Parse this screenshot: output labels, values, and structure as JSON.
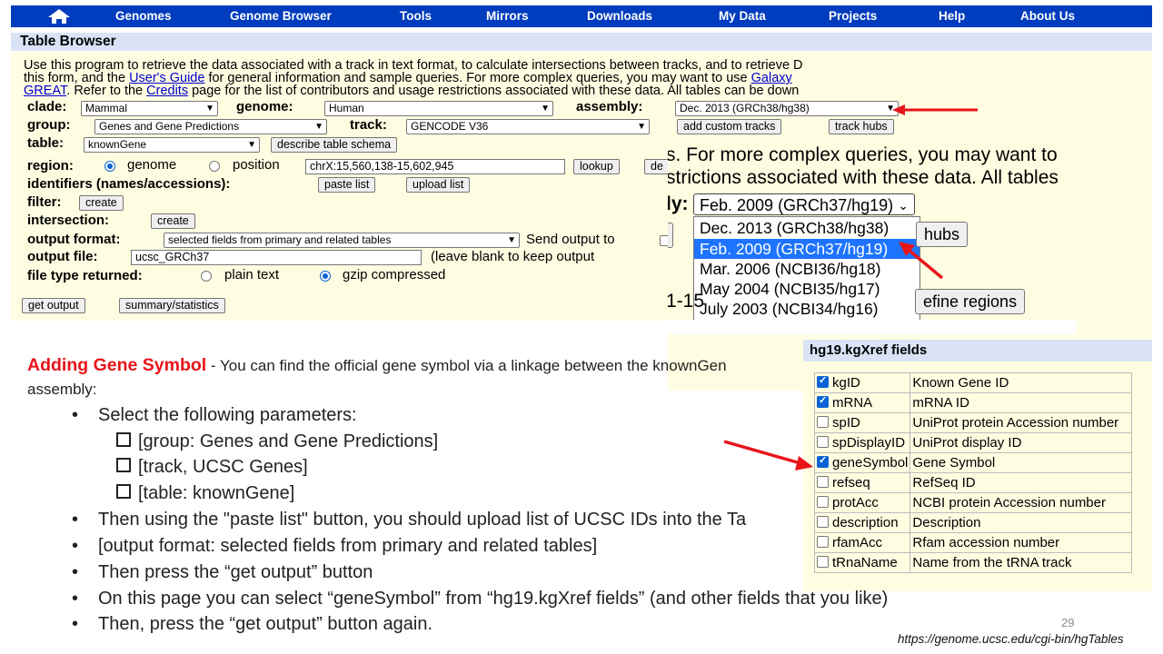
{
  "nav": {
    "items": [
      "Genomes",
      "Genome Browser",
      "Tools",
      "Mirrors",
      "Downloads",
      "My Data",
      "Projects",
      "Help",
      "About Us"
    ]
  },
  "table_browser": {
    "title": "Table Browser",
    "intro": {
      "line1": "Use this program to retrieve the data associated with a track in text format, to calculate intersections between tracks, and to retrieve D",
      "line2_a": "this form, and the ",
      "line2_link1": "User's Guide",
      "line2_b": " for general information and sample queries. For more complex queries, you may want to use ",
      "line2_link2": "Galaxy",
      "line3_link": "GREAT",
      "line3_a": ". Refer to the ",
      "line3_link2": "Credits",
      "line3_b": " page for the list of contributors and usage restrictions associated with these data. All tables can be down"
    },
    "clade_label": "clade:",
    "clade_value": "Mammal",
    "genome_label": "genome:",
    "genome_value": "Human",
    "assembly_label": "assembly:",
    "assembly_value": "Dec. 2013 (GRCh38/hg38)",
    "group_label": "group:",
    "group_value": "Genes and Gene Predictions",
    "track_label": "track:",
    "track_value": "GENCODE V36",
    "add_custom_tracks": "add custom tracks",
    "track_hubs": "track hubs",
    "table_label": "table:",
    "table_value": "knownGene",
    "describe_schema": "describe table schema",
    "region_label": "region:",
    "region_genome": "genome",
    "region_position": "position",
    "position_value": "chrX:15,560,138-15,602,945",
    "lookup": "lookup",
    "define_partial": "de",
    "identifiers_label": "identifiers (names/accessions):",
    "paste_list": "paste list",
    "upload_list": "upload list",
    "filter_label": "filter:",
    "filter_create": "create",
    "intersection_label": "intersection:",
    "intersection_create": "create",
    "output_format_label": "output format:",
    "output_format_value": "selected fields from primary and related tables",
    "send_output_to": "Send output to",
    "output_file_label": "output file:",
    "output_file_value": "ucsc_GRCh37",
    "output_file_hint": "(leave blank to keep output",
    "file_type_label": "file type returned:",
    "file_type_plain": "plain text",
    "file_type_gzip": "gzip compressed",
    "get_output": "get output",
    "summary_statistics": "summary/statistics"
  },
  "zoom": {
    "text_line1": "s. For more complex queries, you may want to",
    "text_line2": "strictions associated with these data. All tables",
    "assembly_label_partial": "ly:",
    "selected": "Feb. 2009 (GRCh37/hg19)",
    "options": [
      "Dec. 2013 (GRCh38/hg38)",
      "Feb. 2009 (GRCh37/hg19)",
      "Mar. 2006 (NCBI36/hg18)",
      "May 2004 (NCBI35/hg17)",
      "July 2003 (NCBI34/hg16)"
    ],
    "highlighted_index": 1,
    "hubs_partial": "hubs",
    "range_partial": "1-15",
    "define_regions_partial": "efine regions"
  },
  "fields": {
    "title": "hg19.kgXref fields",
    "rows": [
      {
        "name": "kgID",
        "desc": "Known Gene ID",
        "checked": true
      },
      {
        "name": "mRNA",
        "desc": "mRNA ID",
        "checked": true
      },
      {
        "name": "spID",
        "desc": "UniProt protein Accession number",
        "checked": false
      },
      {
        "name": "spDisplayID",
        "desc": "UniProt display ID",
        "checked": false
      },
      {
        "name": "geneSymbol",
        "desc": "Gene Symbol",
        "checked": true
      },
      {
        "name": "refseq",
        "desc": "RefSeq ID",
        "checked": false
      },
      {
        "name": "protAcc",
        "desc": "NCBI protein Accession number",
        "checked": false
      },
      {
        "name": "description",
        "desc": "Description",
        "checked": false
      },
      {
        "name": "rfamAcc",
        "desc": "Rfam accession number",
        "checked": false
      },
      {
        "name": "tRnaName",
        "desc": "Name from the tRNA track",
        "checked": false
      }
    ]
  },
  "slide": {
    "heading": "Adding Gene Symbol",
    "heading_rest": " - You can find the official gene symbol via a linkage between the knownGen",
    "heading_line2": "assembly:",
    "bullet1": "Select the following parameters:",
    "sub1": "[group: Genes and Gene Predictions]",
    "sub2": "[track, UCSC Genes]",
    "sub3": "[table: knownGene]",
    "bullet2": "Then using the \"paste list\" button, you should upload list of UCSC IDs into the Ta",
    "bullet3": "[output format: selected fields from primary and related tables]",
    "bullet4": "Then press the “get output” button",
    "bullet5": "On this page you can select “geneSymbol” from “hg19.kgXref fields” (and other fields that you like)",
    "bullet6": "Then, press the “get output” button again.",
    "bullet_char": "•",
    "page_number": "29",
    "source": "https://genome.ucsc.edu/cgi-bin/hgTables"
  },
  "colors": {
    "nav_bg": "#003cbe",
    "panel_bg": "#fffde1",
    "header_bg": "#d9e3f5",
    "accent_red": "#e8141a",
    "highlight_blue": "#1e74ff"
  }
}
